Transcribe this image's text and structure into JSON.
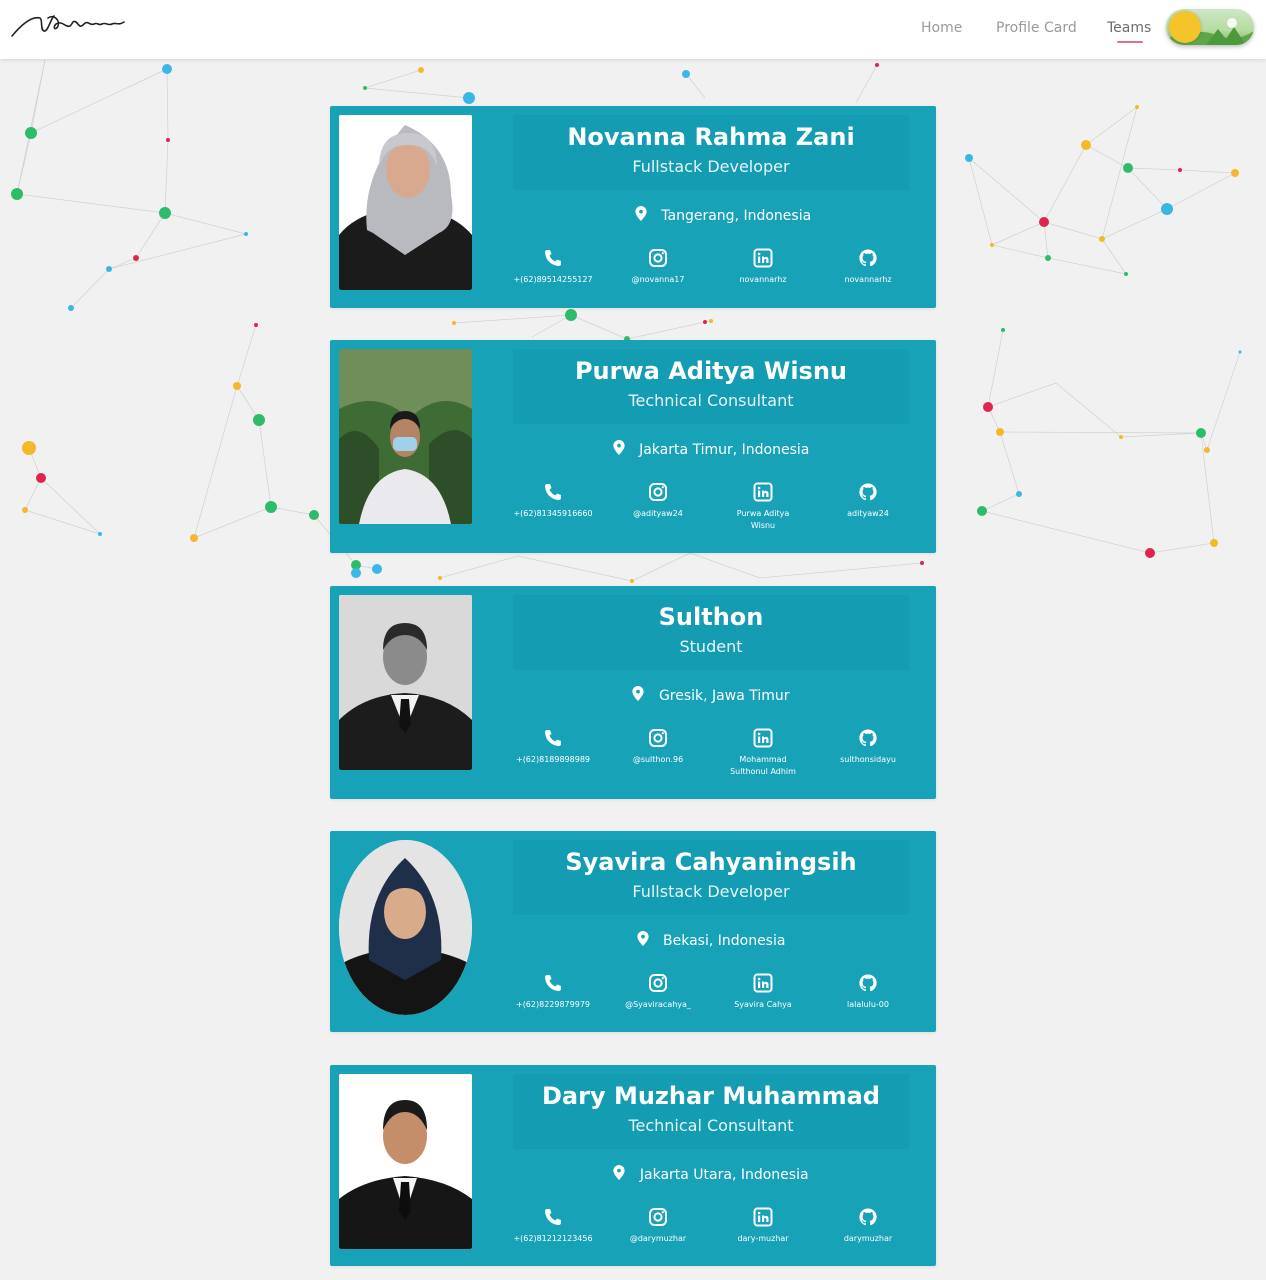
{
  "brand": {
    "logo_text": "Novanna"
  },
  "nav": {
    "links": [
      {
        "label": "Home"
      },
      {
        "label": "Profile Card"
      },
      {
        "label": "Teams"
      }
    ],
    "active": "Teams"
  },
  "colors": {
    "card_background": "#17a2b8",
    "card_header": "#139cb2",
    "page_background": "#f1f1f1",
    "nav_active_underline": "#e07184",
    "network_dot_colors": [
      "#3bb7e6",
      "#2ebc6a",
      "#f5b82a",
      "#e0244f"
    ]
  },
  "icons": {
    "phone": "phone-icon",
    "instagram": "instagram-icon",
    "linkedin": "linkedin-icon",
    "github": "github-icon",
    "location": "map-pin-icon",
    "theme": "sun-icon"
  },
  "members": [
    {
      "name": "Novanna Rahma Zani",
      "role": "Fullstack Developer",
      "location": "Tangerang, Indonesia",
      "phone": "+(62)89514255127",
      "instagram": "@novanna17",
      "linkedin": "novannarhz",
      "github": "novannarhz"
    },
    {
      "name": "Purwa Aditya Wisnu",
      "role": "Technical Consultant",
      "location": "Jakarta Timur, Indonesia",
      "phone": "+(62)81345916660",
      "instagram": "@adityaw24",
      "linkedin": "Purwa Aditya Wisnu",
      "github": "adityaw24"
    },
    {
      "name": "Sulthon",
      "role": "Student",
      "location": "Gresik, Jawa Timur",
      "phone": "+(62)8189898989",
      "instagram": "@sulthon.96",
      "linkedin": "Mohammad Sulthonul Adhim",
      "github": "sulthonsidayu"
    },
    {
      "name": "Syavira Cahyaningsih",
      "role": "Fullstack Developer",
      "location": "Bekasi, Indonesia",
      "phone": "+(62)8229879979",
      "instagram": "@Syaviracahya_",
      "linkedin": "Syavira Cahya",
      "github": "lalalulu-00"
    },
    {
      "name": "Dary Muzhar Muhammad",
      "role": "Technical Consultant",
      "location": "Jakarta Utara, Indonesia",
      "phone": "+(62)81212123456",
      "instagram": "@darymuzhar",
      "linkedin": "dary-muzhar",
      "github": "darymuzhar"
    }
  ]
}
